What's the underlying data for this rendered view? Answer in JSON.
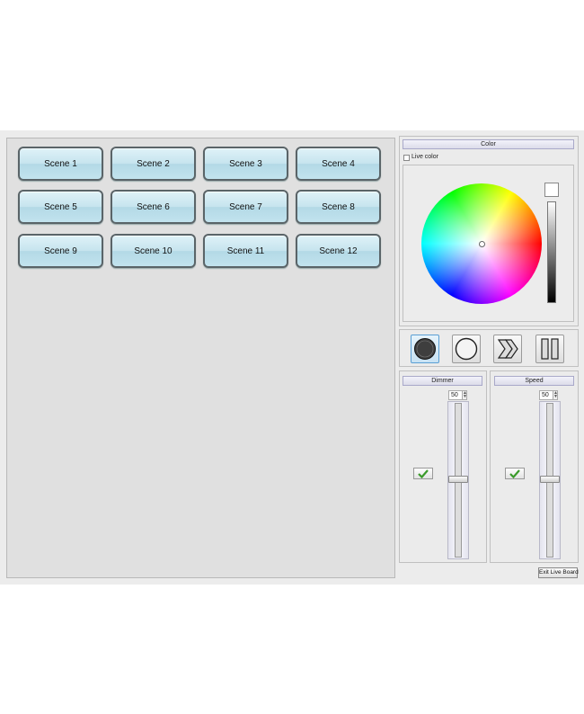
{
  "scenes": [
    {
      "label": "Scene 1"
    },
    {
      "label": "Scene 2"
    },
    {
      "label": "Scene 3"
    },
    {
      "label": "Scene 4"
    },
    {
      "label": "Scene 5"
    },
    {
      "label": "Scene 6"
    },
    {
      "label": "Scene 7"
    },
    {
      "label": "Scene 8"
    },
    {
      "label": "Scene 9"
    },
    {
      "label": "Scene 10"
    },
    {
      "label": "Scene 11"
    },
    {
      "label": "Scene 12"
    }
  ],
  "color_panel": {
    "title": "Color",
    "live_color_label": "Live color",
    "live_color_checked": false,
    "selected_color": "#ffffff"
  },
  "playback": {
    "buttons": [
      {
        "icon": "record-icon",
        "active": true
      },
      {
        "icon": "stop-circle-icon",
        "active": false
      },
      {
        "icon": "fast-forward-icon",
        "active": false
      },
      {
        "icon": "pause-icon",
        "active": false
      }
    ]
  },
  "dimmer": {
    "title": "Dimmer",
    "value": "50",
    "level_percent": 50,
    "enabled": true
  },
  "speed": {
    "title": "Speed",
    "value": "50",
    "level_percent": 50,
    "enabled": true
  },
  "exit_button": {
    "label": "Exit Live Board"
  },
  "colors": {
    "scene_button_fill": "#c6e4ee",
    "scene_button_border": "#5a6468",
    "check_green": "#3a9a2a"
  }
}
